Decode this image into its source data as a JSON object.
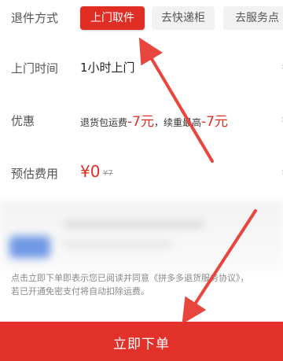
{
  "return_method": {
    "label": "退件方式",
    "options": [
      {
        "label": "上门取件",
        "selected": true
      },
      {
        "label": "去快递柜",
        "selected": false
      },
      {
        "label": "去服务点",
        "selected": false
      }
    ]
  },
  "pickup_time": {
    "label": "上门时间",
    "value": "1小时上门"
  },
  "discount": {
    "label": "优惠",
    "text_prefix": "退货包运费",
    "amount1": "-7元",
    "text_middle": "，续重最高",
    "amount2": "-7元"
  },
  "estimated_fee": {
    "label": "预估费用",
    "price": "¥0",
    "original_price": "¥7"
  },
  "agreement": {
    "line1": "点击立即下单即表示您已阅读并同意《拼多多退货服务协议》，",
    "line2": "若已开通免密支付将自动扣除运费。"
  },
  "submit": {
    "label": "立即下单"
  },
  "colors": {
    "brand_red": "#e02e24",
    "annotation_arrow": "#e8463d"
  }
}
